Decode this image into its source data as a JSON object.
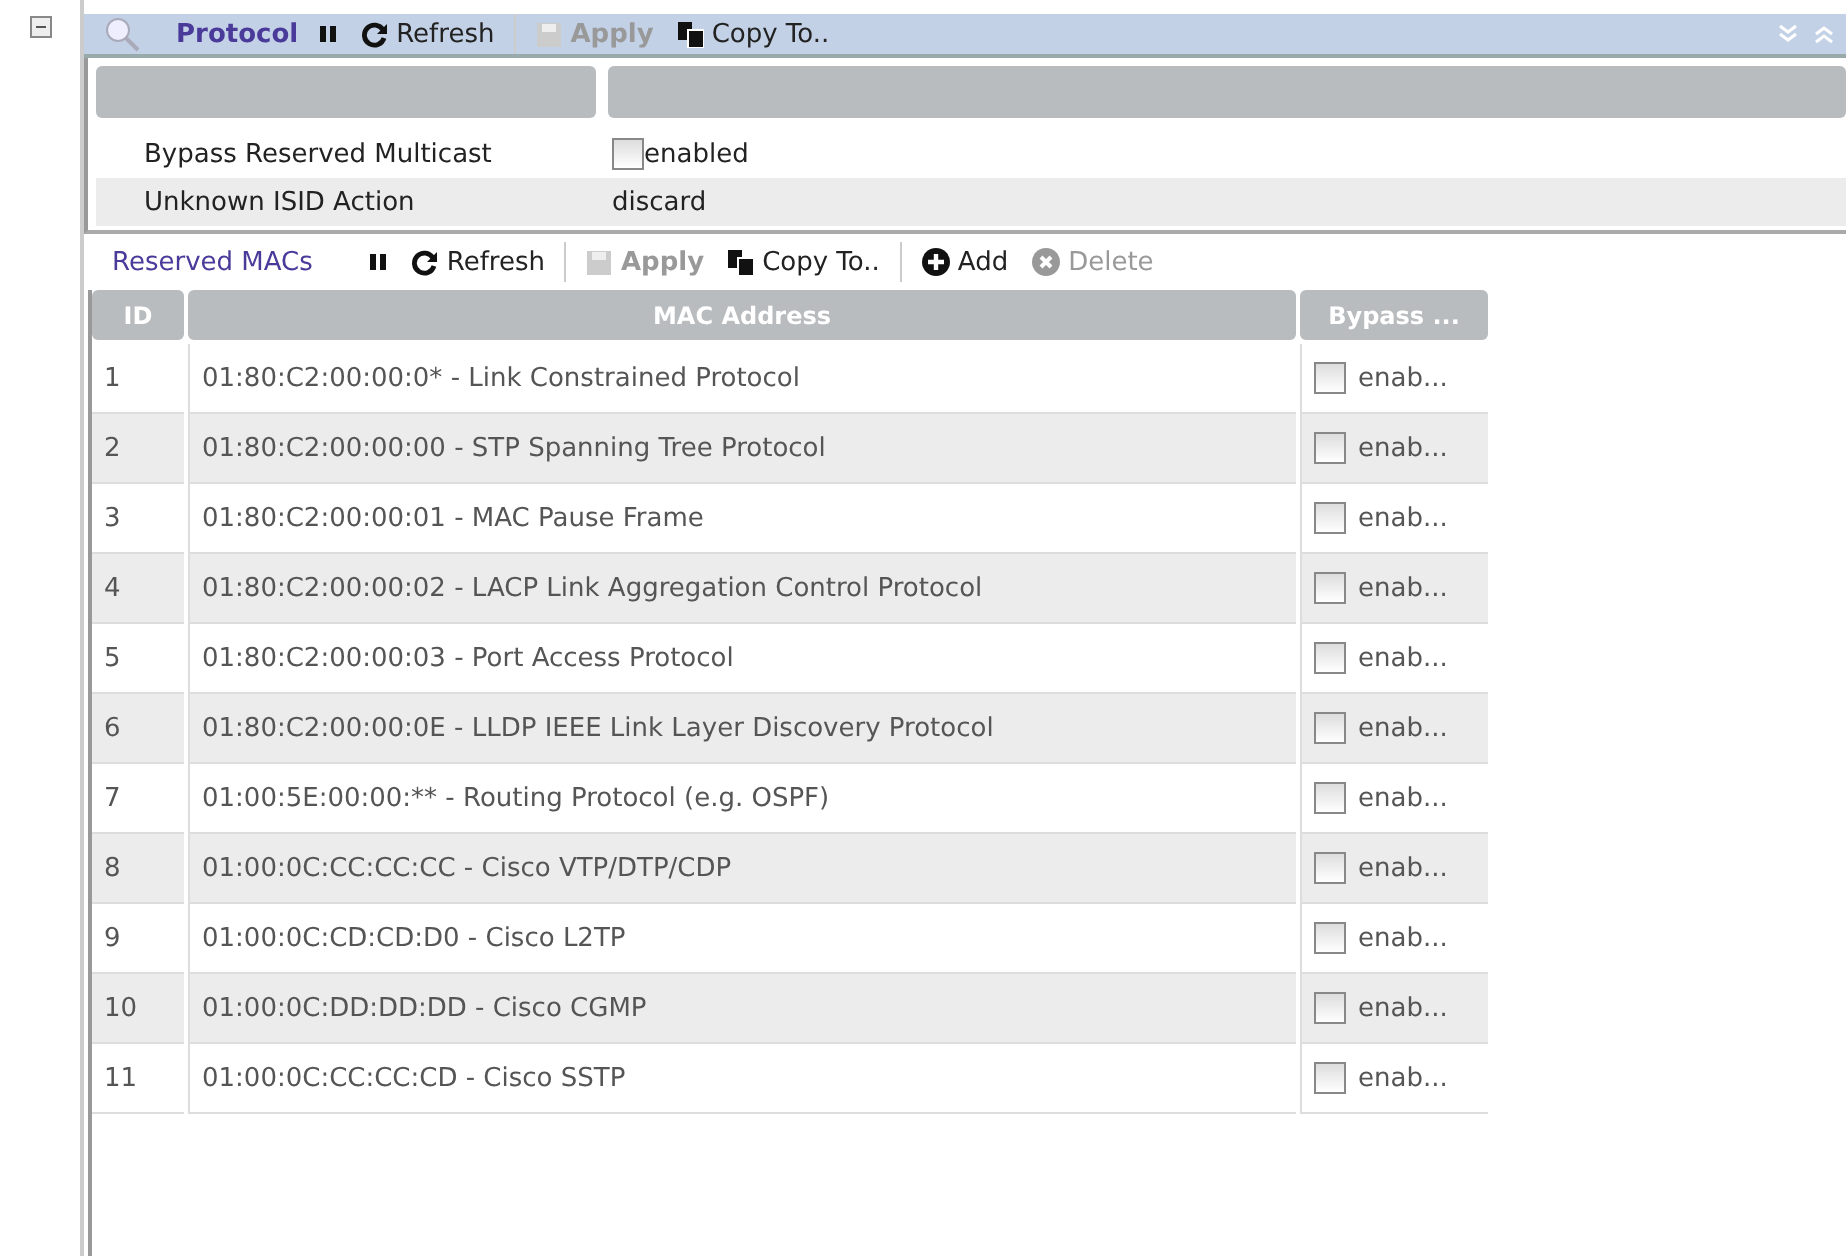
{
  "panel": {
    "title": "Protocol",
    "expanded": true,
    "toolbar": [
      {
        "kind": "pause"
      },
      {
        "kind": "refresh",
        "label": "Refresh"
      },
      {
        "kind": "apply",
        "label": "Apply",
        "disabled": true
      },
      {
        "kind": "copy",
        "label": "Copy To.."
      }
    ]
  },
  "properties": [
    {
      "label": "Bypass Reserved Multicast",
      "kind": "checkbox",
      "checked": false,
      "value": "enabled"
    },
    {
      "label": "Unknown ISID Action",
      "kind": "text",
      "value": "discard"
    }
  ],
  "reserved_macs": {
    "title": "Reserved MACs",
    "toolbar": [
      {
        "kind": "pause"
      },
      {
        "kind": "refresh",
        "label": "Refresh"
      },
      {
        "kind": "apply",
        "label": "Apply",
        "disabled": true
      },
      {
        "kind": "copy",
        "label": "Copy To.."
      },
      {
        "kind": "add",
        "label": "Add",
        "disabled": false
      },
      {
        "kind": "delete",
        "label": "Delete",
        "disabled": true
      }
    ],
    "columns": [
      "ID",
      "MAC Address",
      "Bypass ..."
    ],
    "rows": [
      {
        "id": "1",
        "mac": "01:80:C2:00:00:0* - Link Constrained Protocol",
        "checked": false,
        "bypass": "enab..."
      },
      {
        "id": "2",
        "mac": "01:80:C2:00:00:00 - STP Spanning Tree Protocol",
        "checked": false,
        "bypass": "enab..."
      },
      {
        "id": "3",
        "mac": "01:80:C2:00:00:01 - MAC Pause Frame",
        "checked": false,
        "bypass": "enab..."
      },
      {
        "id": "4",
        "mac": "01:80:C2:00:00:02 - LACP Link Aggregation Control Protocol",
        "checked": false,
        "bypass": "enab..."
      },
      {
        "id": "5",
        "mac": "01:80:C2:00:00:03 - Port Access Protocol",
        "checked": false,
        "bypass": "enab..."
      },
      {
        "id": "6",
        "mac": "01:80:C2:00:00:0E - LLDP IEEE Link Layer Discovery Protocol",
        "checked": false,
        "bypass": "enab..."
      },
      {
        "id": "7",
        "mac": "01:00:5E:00:00:** - Routing Protocol (e.g. OSPF)",
        "checked": false,
        "bypass": "enab..."
      },
      {
        "id": "8",
        "mac": "01:00:0C:CC:CC:CC - Cisco VTP/DTP/CDP",
        "checked": false,
        "bypass": "enab..."
      },
      {
        "id": "9",
        "mac": "01:00:0C:CD:CD:D0 - Cisco L2TP",
        "checked": false,
        "bypass": "enab..."
      },
      {
        "id": "10",
        "mac": "01:00:0C:DD:DD:DD - Cisco CGMP",
        "checked": false,
        "bypass": "enab..."
      },
      {
        "id": "11",
        "mac": "01:00:0C:CC:CC:CD - Cisco SSTP",
        "checked": false,
        "bypass": "enab..."
      }
    ]
  }
}
